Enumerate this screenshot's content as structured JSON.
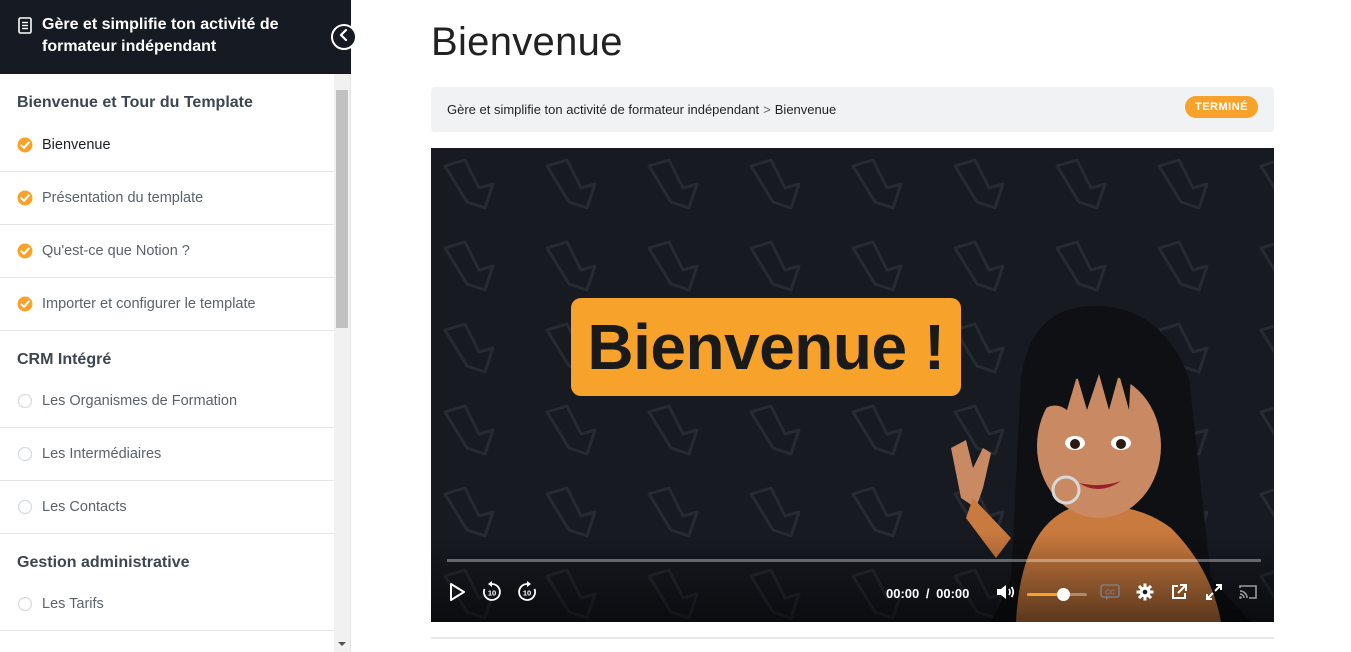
{
  "sidebar": {
    "title": "Gère et simplifie ton activité de formateur indépendant",
    "sections": [
      {
        "title": "Bienvenue et Tour du Template",
        "lessons": [
          {
            "label": "Bienvenue",
            "done": true,
            "active": true
          },
          {
            "label": "Présentation du template",
            "done": true
          },
          {
            "label": "Qu'est-ce que Notion ?",
            "done": true
          },
          {
            "label": "Importer et configurer le template",
            "done": true
          }
        ]
      },
      {
        "title": "CRM Intégré",
        "lessons": [
          {
            "label": "Les Organismes de Formation",
            "done": false
          },
          {
            "label": "Les Intermédiaires",
            "done": false
          },
          {
            "label": "Les Contacts",
            "done": false
          }
        ]
      },
      {
        "title": "Gestion administrative",
        "lessons": [
          {
            "label": "Les Tarifs",
            "done": false
          }
        ]
      }
    ]
  },
  "main": {
    "title": "Bienvenue",
    "breadcrumb": {
      "course": "Gère et simplifie ton activité de formateur indépendant",
      "separator": ">",
      "current": "Bienvenue"
    },
    "status": "TERMINÉ"
  },
  "video": {
    "overlay_text": "Bienvenue !",
    "current_time": "00:00",
    "time_separator": "/",
    "duration": "00:00",
    "volume_fraction": 0.6,
    "progress_fraction": 0
  },
  "colors": {
    "accent": "#f7a22b",
    "sidebar_header": "#161a22",
    "video_bg": "#171a21"
  }
}
